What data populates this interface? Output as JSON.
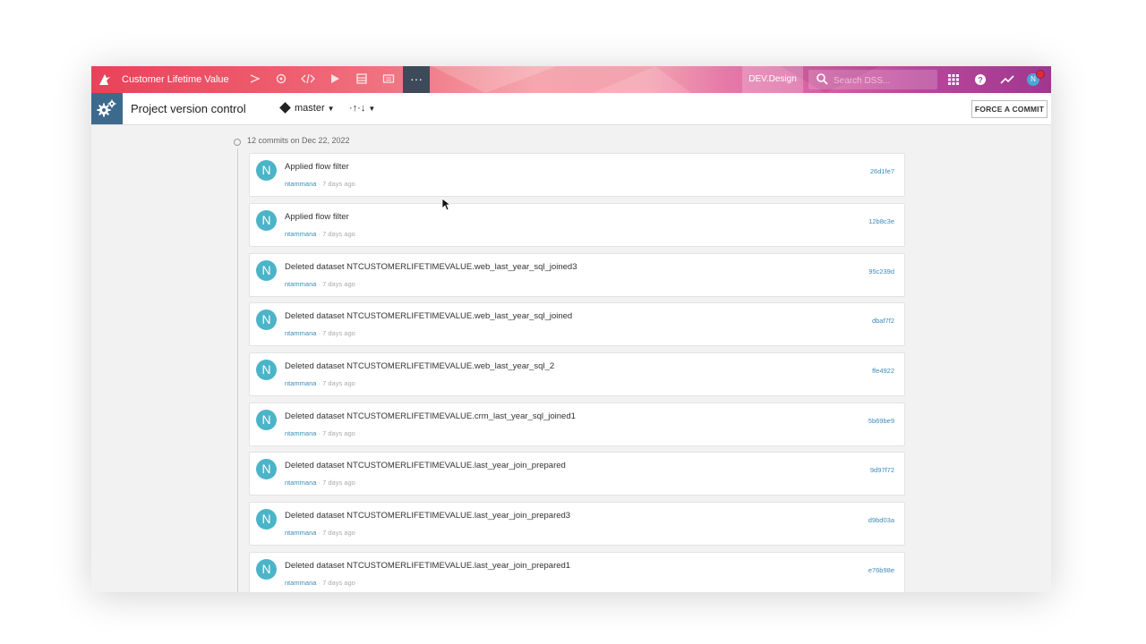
{
  "topbar": {
    "project_title": "Customer Lifetime Value",
    "more_label": "···",
    "env_label": "DEV.Design",
    "search_placeholder": "Search DSS...",
    "user_initial": "N"
  },
  "subheader": {
    "title": "Project version control",
    "branch": "master",
    "sync_label": "·↑·↓",
    "force_commit_label": "FORCE A COMMIT"
  },
  "timeline": {
    "group_header": "12 commits on Dec 22, 2022",
    "commits": [
      {
        "initial": "N",
        "message": "Applied flow filter",
        "author": "ntammana",
        "when": " · 7 days ago",
        "hash": "26d1fe7"
      },
      {
        "initial": "N",
        "message": "Applied flow filter",
        "author": "ntammana",
        "when": " · 7 days ago",
        "hash": "12b8c3e"
      },
      {
        "initial": "N",
        "message": "Deleted dataset NTCUSTOMERLIFETIMEVALUE.web_last_year_sql_joined3",
        "author": "ntammana",
        "when": " · 7 days ago",
        "hash": "95c239d"
      },
      {
        "initial": "N",
        "message": "Deleted dataset NTCUSTOMERLIFETIMEVALUE.web_last_year_sql_joined",
        "author": "ntammana",
        "when": " · 7 days ago",
        "hash": "dbaf7f2"
      },
      {
        "initial": "N",
        "message": "Deleted dataset NTCUSTOMERLIFETIMEVALUE.web_last_year_sql_2",
        "author": "ntammana",
        "when": " · 7 days ago",
        "hash": "ffe4922"
      },
      {
        "initial": "N",
        "message": "Deleted dataset NTCUSTOMERLIFETIMEVALUE.crm_last_year_sql_joined1",
        "author": "ntammana",
        "when": " · 7 days ago",
        "hash": "5b69be9"
      },
      {
        "initial": "N",
        "message": "Deleted dataset NTCUSTOMERLIFETIMEVALUE.last_year_join_prepared",
        "author": "ntammana",
        "when": " · 7 days ago",
        "hash": "9d97f72"
      },
      {
        "initial": "N",
        "message": "Deleted dataset NTCUSTOMERLIFETIMEVALUE.last_year_join_prepared3",
        "author": "ntammana",
        "when": " · 7 days ago",
        "hash": "d9bd03a"
      },
      {
        "initial": "N",
        "message": "Deleted dataset NTCUSTOMERLIFETIMEVALUE.last_year_join_prepared1",
        "author": "ntammana",
        "when": " · 7 days ago",
        "hash": "e76b98e"
      }
    ]
  },
  "icons": {
    "logo": "bird-logo-icon",
    "flow": "flow-icon",
    "refresh": "refresh-icon",
    "code": "code-icon",
    "run": "play-icon",
    "jobs": "dashboard-icon",
    "wiki": "wiki-icon",
    "search": "search-icon",
    "apps": "grid-icon",
    "help": "help-icon",
    "activity": "trend-icon",
    "settings_tile": "gears-icon"
  },
  "colors": {
    "accent_blue": "#3d8bb8",
    "avatar_teal": "#4bb4c8",
    "tile_blue": "#3c6a8d"
  }
}
